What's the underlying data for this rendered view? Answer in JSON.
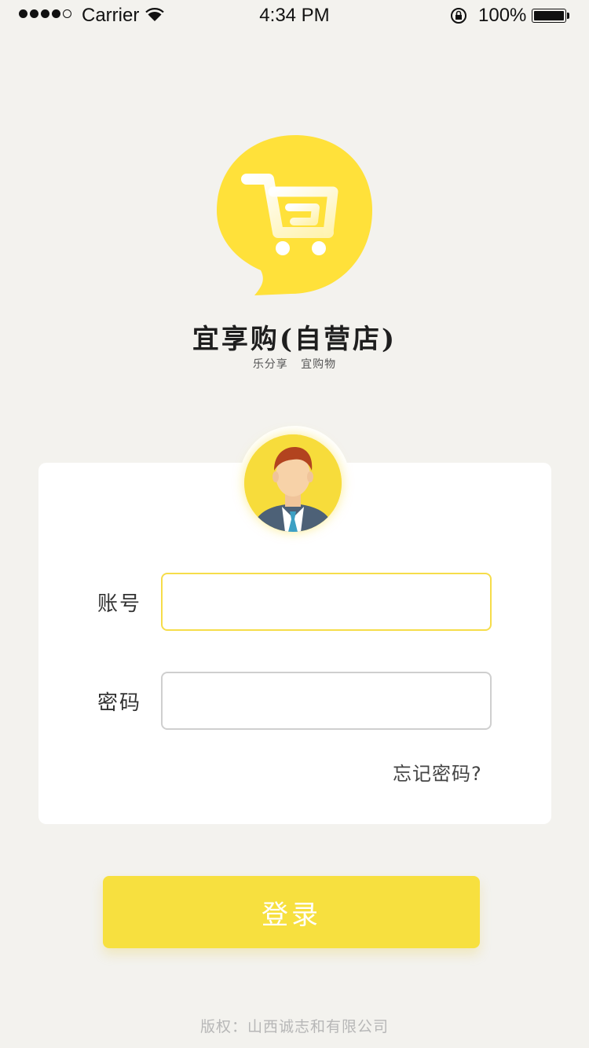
{
  "status_bar": {
    "carrier": "Carrier",
    "time": "4:34 PM",
    "battery": "100%",
    "signal_bars": 4,
    "signal_total": 5
  },
  "app": {
    "title": "宜享购(自营店)",
    "slogan": "乐分享   宜购物",
    "logo_icon": "shopping-cart-icon",
    "brand_color": "#ffe13a"
  },
  "login_form": {
    "account_label": "账号",
    "account_value": "",
    "password_label": "密码",
    "password_value": "",
    "forgot_link": "忘记密码?",
    "submit_label": "登录",
    "avatar_icon": "user-avatar-icon"
  },
  "footer": {
    "copyright": "版权：山西诚志和有限公司"
  },
  "colors": {
    "background": "#f3f2ee",
    "accent": "#f7e03f",
    "focus_border": "#f6dd4a"
  }
}
